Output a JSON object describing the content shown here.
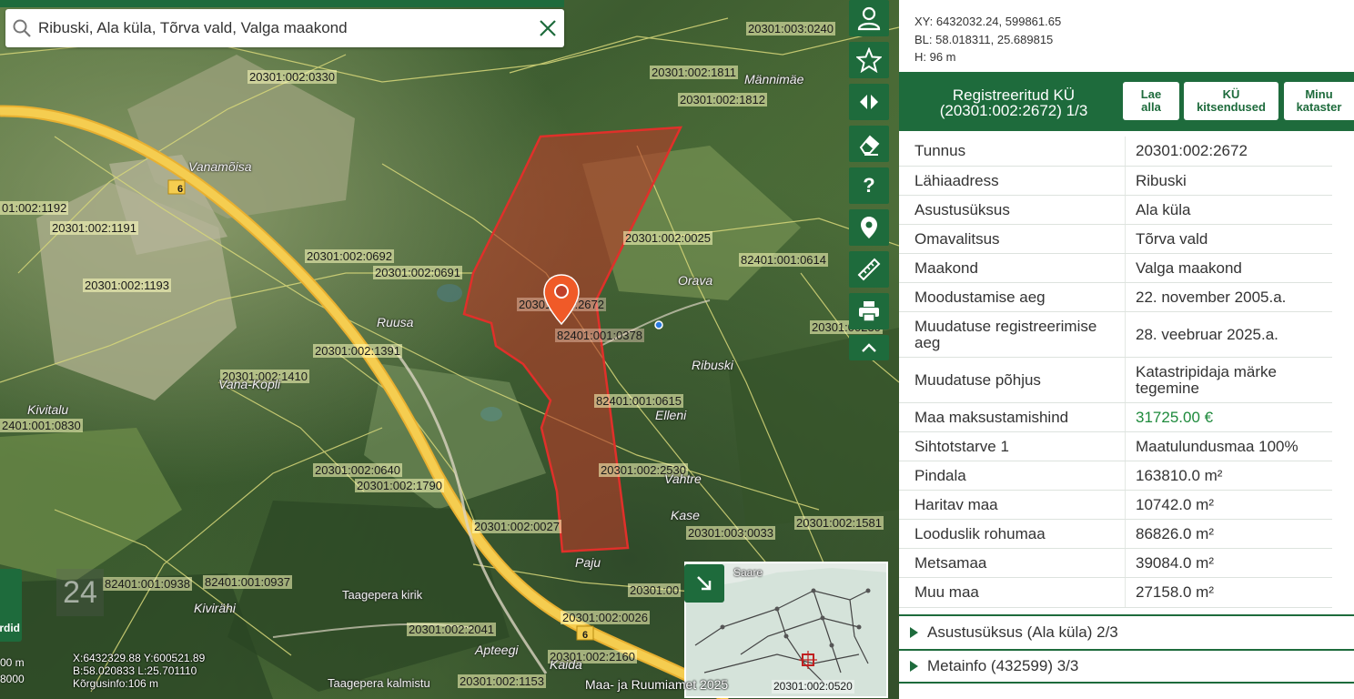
{
  "search": {
    "value": "Ribuski, Ala küla, Tõrva vald, Valga maakond"
  },
  "map": {
    "parcel_labels": [
      "20301:003:0240",
      "20301:002:1811",
      "20301:002:1812",
      "20301:002:0330",
      "01:002:1192",
      "20301:002:1191",
      "20301:002:1193",
      "20301:002:0692",
      "20301:002:0691",
      "20301:002:0025",
      "82401:001:0614",
      "20301:002:2672",
      "82401:001:0378",
      "20301:002:1391",
      "20301:002:1410",
      "82401:001:0615",
      "2401:001:0830",
      "20301:002:0640",
      "20301:002:1790",
      "20301:002:2530",
      "20301:002:0027",
      "20301:003:0033",
      "20301:002:1581",
      "82401:001:0938",
      "82401:001:0937",
      "20301:002:2041",
      "20301:002:0026",
      "20301:002:2160",
      "20301:002:1153",
      "20301:00",
      "20301:00230"
    ],
    "place_names": [
      "Männimäe",
      "Vanamõisa",
      "Orava",
      "Ruusa",
      "Ribuski",
      "Vana-Kopli",
      "Elleni",
      "Kivitalu",
      "Vahtre",
      "Kase",
      "Paju",
      "Kivirähi",
      "Taagepera kirik",
      "Apteegi",
      "Kaida",
      "Taagepera kalmistu",
      "Saare"
    ],
    "road_number": "6",
    "zoom_level": "24",
    "cursor_coords": [
      "X:6432329.88 Y:600521.89",
      "B:58.020833 L:25.701110",
      "Kõrgusinfo:106 m"
    ],
    "scale": [
      "00 m",
      "8000"
    ],
    "copyright": "Maa- ja Ruumiamet 2025",
    "left_button_label": "rdid",
    "minimap_label": "20301:002:0520"
  },
  "toolbar": {
    "icons": [
      "user-icon",
      "star-icon",
      "compare-arrows-icon",
      "eraser-icon",
      "help-icon",
      "location-pin-icon",
      "ruler-icon",
      "print-icon",
      "chevron-up-icon"
    ],
    "help_label": "?"
  },
  "panel": {
    "xy": "XY: 6432032.24, 599861.65",
    "bl": "BL: 58.018311, 25.689815",
    "h": "H: 96 m",
    "header_title_line1": "Registreeritud KÜ",
    "header_title_line2": "(20301:002:2672) 1/3",
    "btn_download_1": "Lae",
    "btn_download_2": "alla",
    "btn_restrictions_1": "KÜ",
    "btn_restrictions_2": "kitsendused",
    "btn_my_1": "Minu",
    "btn_my_2": "kataster",
    "rows": [
      {
        "k": "Tunnus",
        "v": "20301:002:2672"
      },
      {
        "k": "Lähiaadress",
        "v": "Ribuski"
      },
      {
        "k": "Asustusüksus",
        "v": "Ala küla"
      },
      {
        "k": "Omavalitsus",
        "v": "Tõrva vald"
      },
      {
        "k": "Maakond",
        "v": "Valga maakond"
      },
      {
        "k": "Moodustamise aeg",
        "v": "22. november 2005.a."
      },
      {
        "k": "Muudatuse registreerimise aeg",
        "v": "28. veebruar 2025.a."
      },
      {
        "k": "Muudatuse põhjus",
        "v": "Katastripidaja märke tegemine"
      },
      {
        "k": "Maa maksustamishind",
        "v": "31725.00 €"
      },
      {
        "k": "Sihtotstarve 1",
        "v": "Maatulundusmaa 100%"
      },
      {
        "k": "Pindala",
        "v": "163810.0 m²"
      },
      {
        "k": "Haritav maa",
        "v": "10742.0 m²"
      },
      {
        "k": "Looduslik rohumaa",
        "v": "86826.0 m²"
      },
      {
        "k": "Metsamaa",
        "v": "39084.0 m²"
      },
      {
        "k": "Muu maa",
        "v": "27158.0 m²"
      }
    ],
    "section_settlement": "Asustusüksus (Ala küla) 2/3",
    "section_metainfo": "Metainfo (432599) 3/3"
  },
  "colors": {
    "brand_green": "#1e6b3c",
    "parcel_red": "#e0302a",
    "price_green": "#1e8a3c"
  }
}
